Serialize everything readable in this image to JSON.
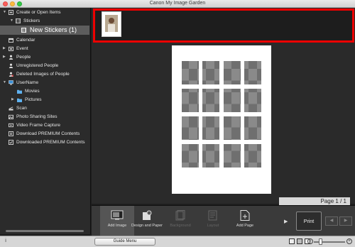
{
  "window": {
    "title": "Canon My Image Garden"
  },
  "sidebar": {
    "items": [
      {
        "label": "Create or Open Items",
        "icon": "create-items-icon",
        "expanded": true
      },
      {
        "label": "Stickers",
        "icon": "stickers-icon",
        "expanded": true
      },
      {
        "label": "New Stickers (1)",
        "icon": "sticker-doc-icon",
        "selected": true
      },
      {
        "label": "Calendar",
        "icon": "calendar-icon"
      },
      {
        "label": "Event",
        "icon": "event-icon",
        "collapsed": true
      },
      {
        "label": "People",
        "icon": "people-icon",
        "collapsed": true
      },
      {
        "label": "Unregistered People",
        "icon": "unregistered-people-icon"
      },
      {
        "label": "Deleted Images of People",
        "icon": "deleted-people-icon"
      },
      {
        "label": "UserName",
        "icon": "computer-icon",
        "expanded": true
      },
      {
        "label": "Movies",
        "icon": "folder-icon"
      },
      {
        "label": "Pictures",
        "icon": "folder-icon",
        "collapsed": true
      },
      {
        "label": "Scan",
        "icon": "scan-icon"
      },
      {
        "label": "Photo Sharing Sites",
        "icon": "photo-sharing-icon"
      },
      {
        "label": "Video Frame Capture",
        "icon": "video-capture-icon"
      },
      {
        "label": "Download PREMIUM Contents",
        "icon": "download-premium-icon"
      },
      {
        "label": "Downloaded PREMIUM Contents",
        "icon": "downloaded-premium-icon"
      }
    ]
  },
  "editor": {
    "page_indicator": "Page 1 / 1"
  },
  "toolbar": {
    "add_image": "Add Image",
    "design_paper": "Design and Paper",
    "background": "Background",
    "layout": "Layout",
    "add_page": "Add Page",
    "print": "Print",
    "prev": "◀",
    "next": "▶"
  },
  "statusbar": {
    "guide_menu": "Guide Menu",
    "info": "i"
  },
  "colors": {
    "highlight": "#e00000",
    "sidebar_bg": "#2b2b2b",
    "selected_bg": "#5d5d5d"
  }
}
